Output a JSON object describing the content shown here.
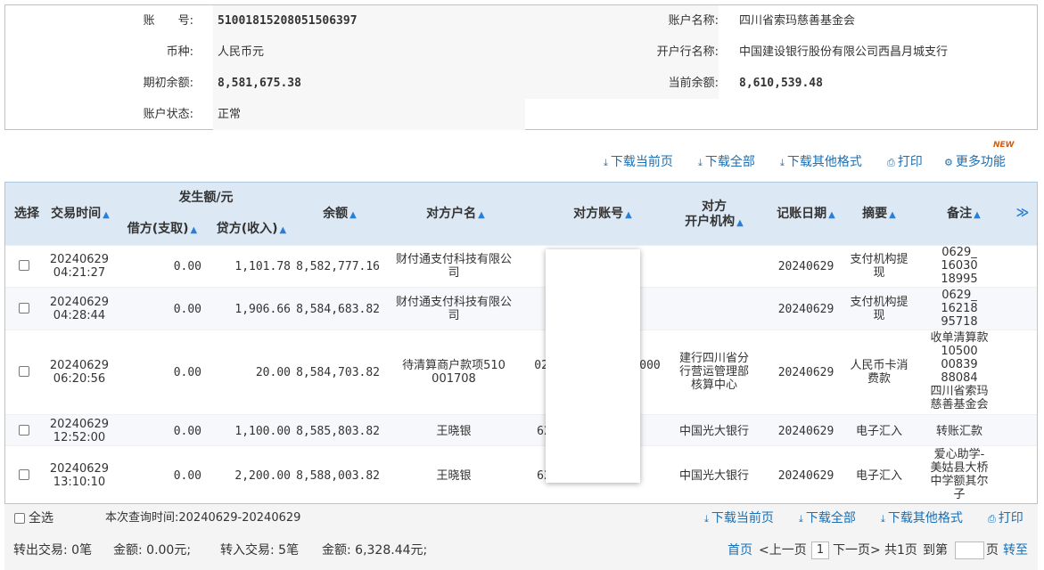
{
  "account": {
    "account_no_label": "账　　号:",
    "account_no": "51001815208051506397",
    "account_name_label": "账户名称:",
    "account_name": "四川省索玛慈善基金会",
    "currency_label": "币种:",
    "currency": "人民币元",
    "bank_label": "开户行名称:",
    "bank": "中国建设银行股份有限公司西昌月城支行",
    "opening_balance_label": "期初余额:",
    "opening_balance": "8,581,675.38",
    "current_balance_label": "当前余额:",
    "current_balance": "8,610,539.48",
    "status_label": "账户状态:",
    "status": "正常"
  },
  "toolbar": {
    "download_page": "下载当前页",
    "download_all": "下载全部",
    "download_other": "下载其他格式",
    "print": "打印",
    "more": "更多功能",
    "new_badge": "NEW"
  },
  "table": {
    "headers": {
      "select": "选择",
      "time": "交易时间",
      "amount_group": "发生额/元",
      "debit": "借方(支取)",
      "credit": "贷方(收入)",
      "balance": "余额",
      "counterparty_name": "对方户名",
      "counterparty_account": "对方账号",
      "counterparty_bank_1": "对方",
      "counterparty_bank_2": "开户机构",
      "posting_date": "记账日期",
      "summary": "摘要",
      "remark": "备注",
      "more": "≫"
    },
    "rows": [
      {
        "date": "20240629",
        "time": "04:21:27",
        "debit": "0.00",
        "credit": "1,101.78",
        "balance": "8,582,777.16",
        "name_1": "财付通支付科技有限公",
        "name_2": "司",
        "account": "",
        "bank": "",
        "bank_2": "",
        "bank_3": "",
        "posting": "20240629",
        "summary_1": "支付机构提",
        "summary_2": "现",
        "remark_1": "0629_",
        "remark_2": "16030",
        "remark_3": "18995"
      },
      {
        "date": "20240629",
        "time": "04:28:44",
        "debit": "0.00",
        "credit": "1,906.66",
        "balance": "8,584,683.82",
        "name_1": "财付通支付科技有限公",
        "name_2": "司",
        "account": "",
        "bank": "",
        "bank_2": "",
        "bank_3": "",
        "posting": "20240629",
        "summary_1": "支付机构提",
        "summary_2": "现",
        "remark_1": "0629_",
        "remark_2": "16218",
        "remark_3": "95718"
      },
      {
        "date": "20240629",
        "time": "06:20:56",
        "debit": "0.00",
        "credit": "20.00",
        "balance": "8,584,703.82",
        "name_1": "待清算商户款项510",
        "name_2": "001708",
        "account": "029",
        "account_tail": "000",
        "bank": "建行四川省分",
        "bank_2": "行营运管理部",
        "bank_3": "核算中心",
        "posting": "20240629",
        "summary_1": "人民币卡消",
        "summary_2": "费款",
        "remark_1": "收单清算款",
        "remark_2": "10500",
        "remark_3": "00839",
        "remark_4": "88084",
        "remark_5": "四川省索玛",
        "remark_6": "慈善基金会"
      },
      {
        "date": "20240629",
        "time": "12:52:00",
        "debit": "0.00",
        "credit": "1,100.00",
        "balance": "8,585,803.82",
        "name_1": "王晓银",
        "account": "62",
        "bank": "中国光大银行",
        "posting": "20240629",
        "summary_1": "电子汇入",
        "remark_1": "转账汇款"
      },
      {
        "date": "20240629",
        "time": "13:10:10",
        "debit": "0.00",
        "credit": "2,200.00",
        "balance": "8,588,003.82",
        "name_1": "王晓银",
        "account": "62",
        "bank": "中国光大银行",
        "posting": "20240629",
        "summary_1": "电子汇入",
        "remark_1": "爱心助学-",
        "remark_2": "美姑县大桥",
        "remark_3": "中学额其尔",
        "remark_4": "子"
      }
    ]
  },
  "footer": {
    "select_all": "全选",
    "query_time": "本次查询时间:20240629-20240629",
    "out_tx": "转出交易: 0笔",
    "out_amount": "金额: 0.00元;",
    "in_tx": "转入交易: 5笔",
    "in_amount": "金额: 6,328.44元;",
    "first": "首页",
    "prev": "<上一页",
    "page": "1",
    "next": "下一页>",
    "total": "共1页",
    "goto": "到第",
    "page_unit": "页",
    "go": "转至"
  }
}
